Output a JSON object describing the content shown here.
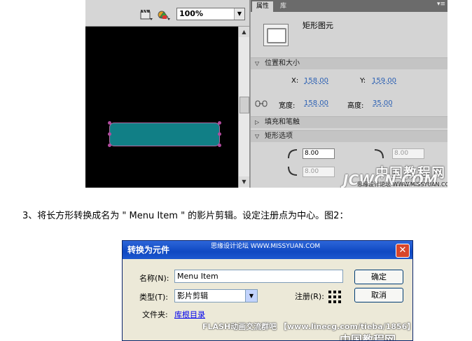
{
  "flash_ui": {
    "zoom_value": "100%",
    "panel_tabs": [
      "属性",
      "库"
    ],
    "panel_menu": "▾≡",
    "symbol_type": "矩形图元",
    "sections": {
      "position_size": "位置和大小",
      "fill_stroke": "填充和笔触",
      "rect_options": "矩形选项"
    },
    "position": {
      "x_label": "X:",
      "x_value": "158.00",
      "y_label": "Y:",
      "y_value": "159.00"
    },
    "size": {
      "width_label": "宽度:",
      "width_value": "158.00",
      "height_label": "高度:",
      "height_value": "35.00"
    },
    "corners": {
      "top_left": "8.00",
      "top_right": "8.00",
      "bottom_left": "8.00"
    },
    "rect_fill_color": "#117f86",
    "watermark_1": "中国教程网",
    "watermark_2": "思缘设计论坛 WWW.MISSYUAN.COM",
    "watermark_3": "JCWCN.COM"
  },
  "instruction_text": "3、将长方形转换成名为 \" Menu Item \" 的影片剪辑。设定注册点为中心。图2：",
  "dialog": {
    "title": "转换为元件",
    "close_icon": "close-icon",
    "watermark_top": "思缘设计论坛 WWW.MISSYUAN.COM",
    "name_label": "名称(N):",
    "name_value": "Menu Item",
    "type_label": "类型(T):",
    "type_value": "影片剪辑",
    "registration_label": "注册(R):",
    "folder_label": "文件夹:",
    "folder_link": "库根目录",
    "ok_button": "确定",
    "cancel_button": "取消",
    "watermark_bottom": "FLASH动画交流群吧 【www.linecg.com/tieba/1856】",
    "watermark_logo": "中国教程网"
  }
}
